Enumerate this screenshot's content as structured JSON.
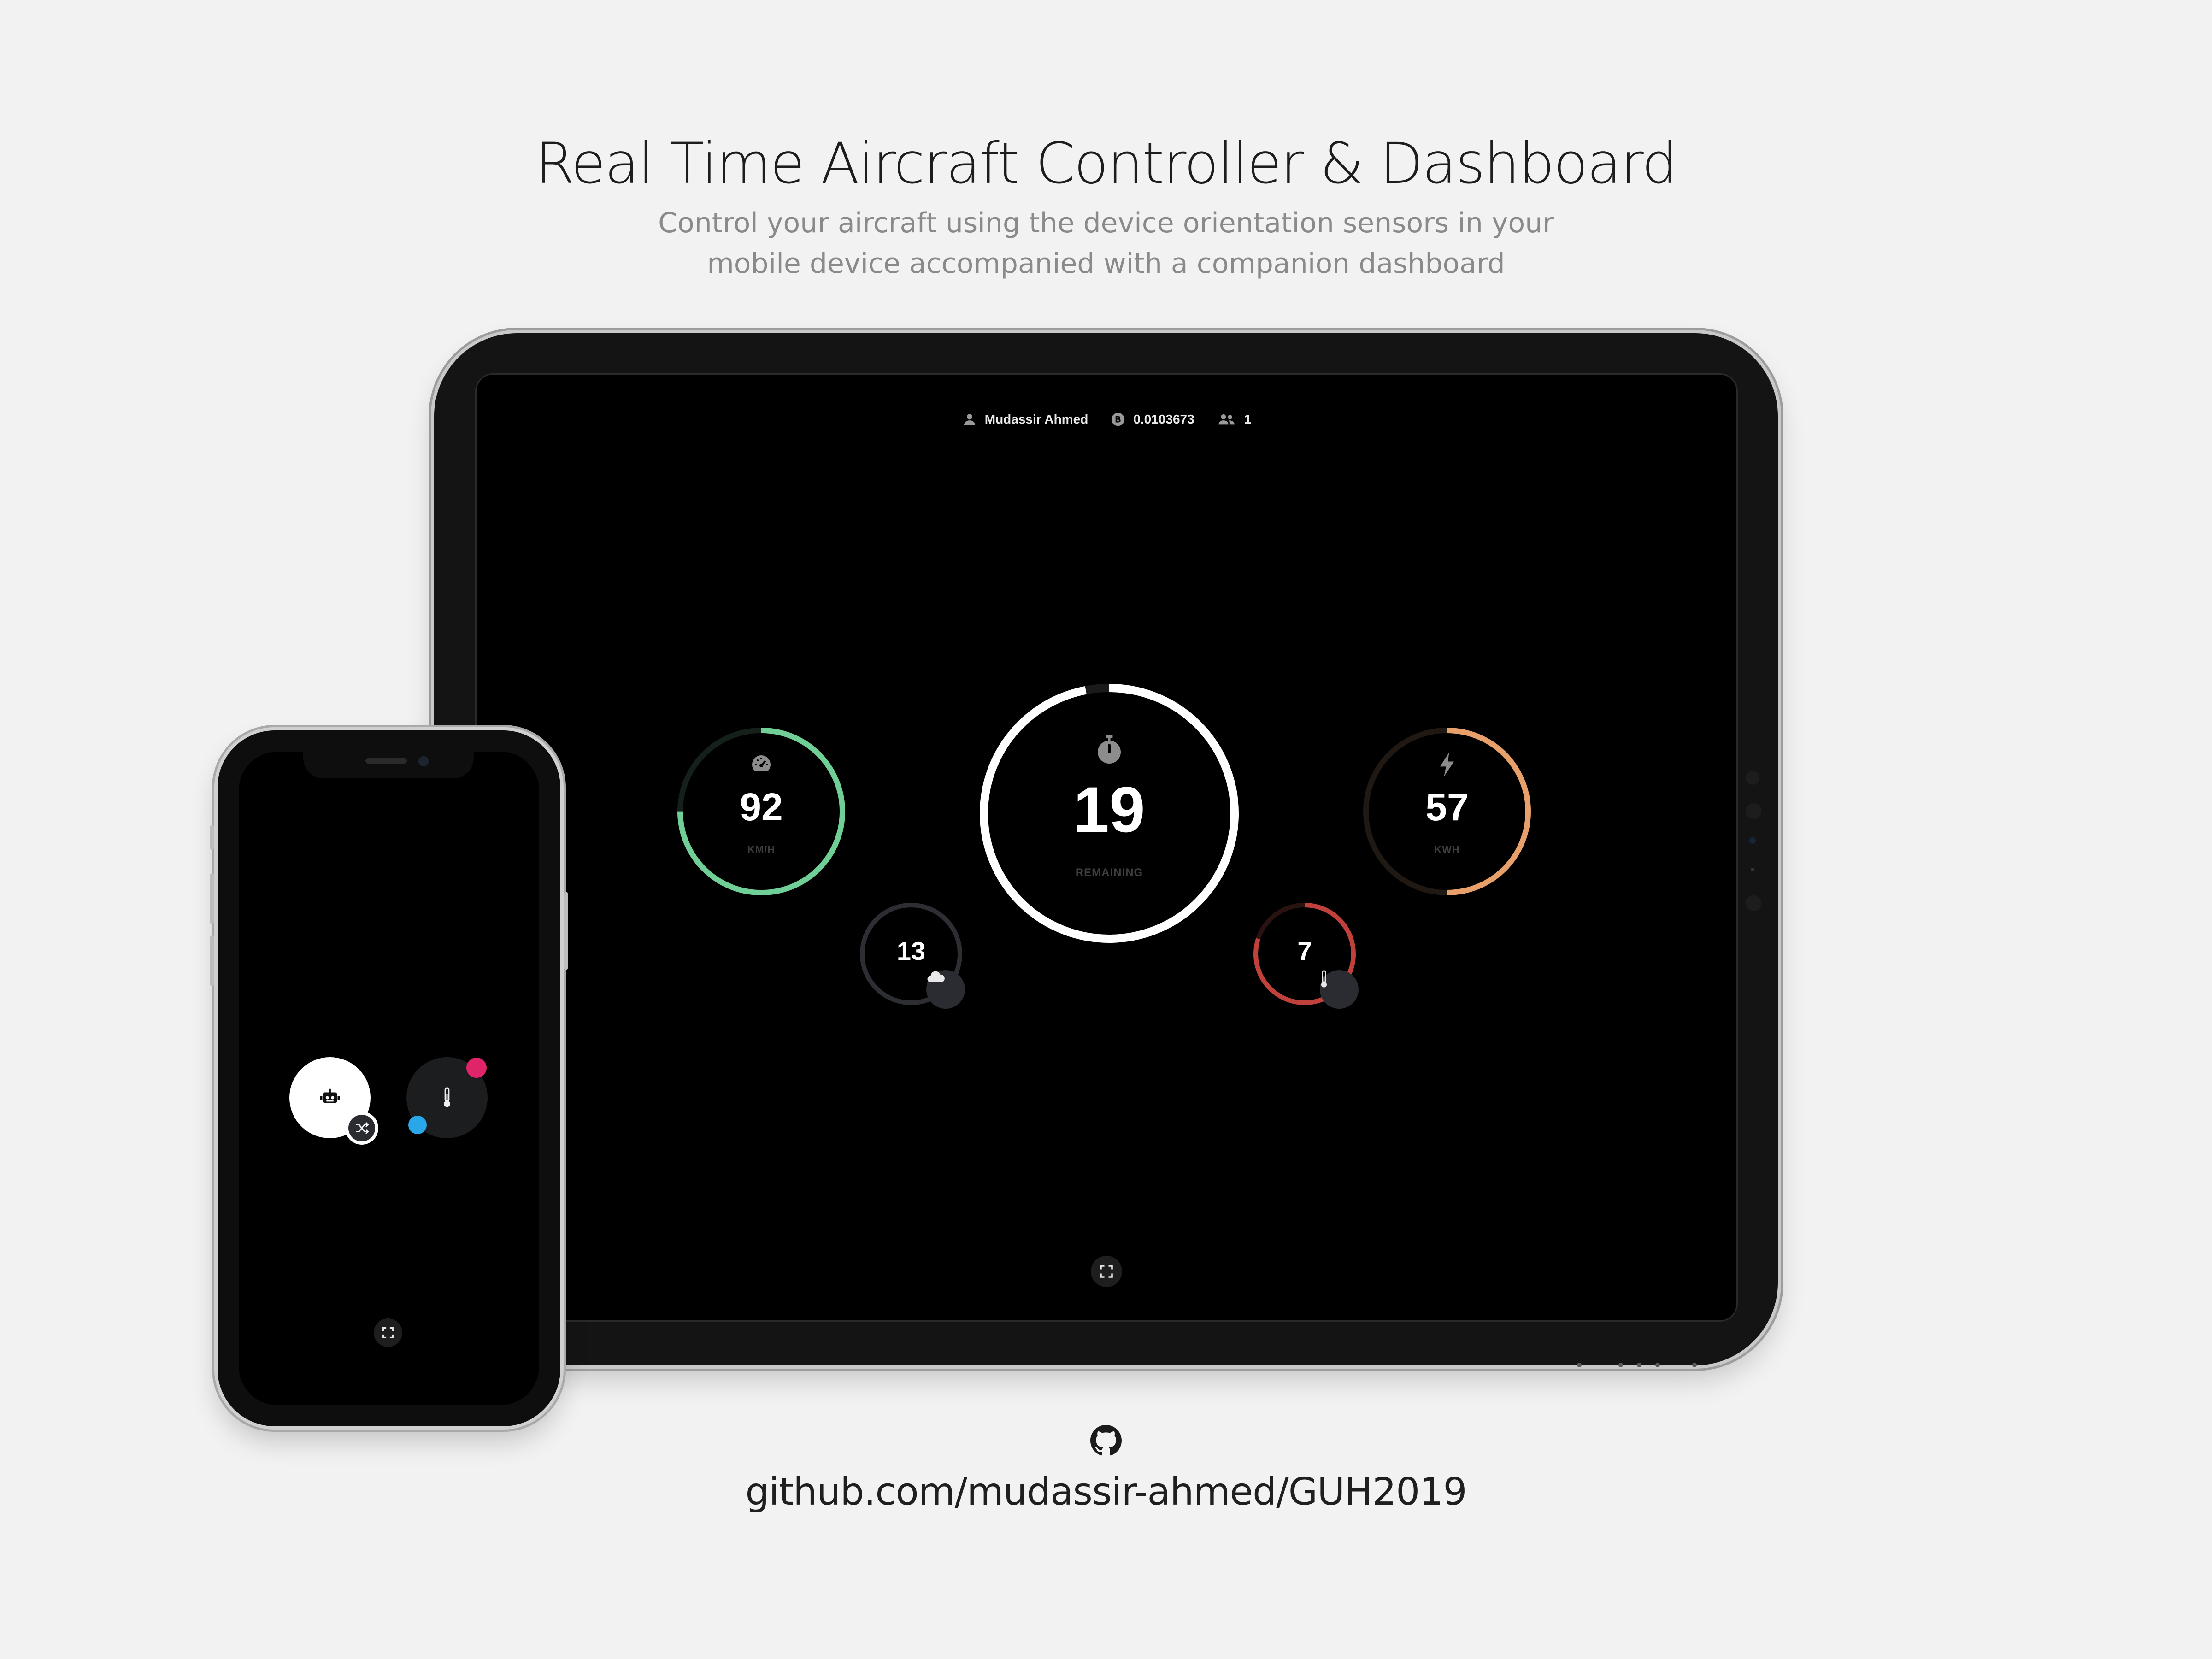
{
  "hero": {
    "title": "Real Time Aircraft Controller & Dashboard",
    "subtitle_line1": "Control your aircraft using the device orientation sensors in your",
    "subtitle_line2": "mobile device accompanied with a companion dashboard"
  },
  "tablet": {
    "topbar": {
      "user_name": "Mudassir Ahmed",
      "balance": "0.0103673",
      "players": "1",
      "icons": [
        "user-icon",
        "coin-icon",
        "users-icon"
      ]
    },
    "gauges": {
      "speed": {
        "value": "92",
        "unit": "KM/H",
        "icon": "speedometer-icon",
        "color": "#6fcf97",
        "fill": 0.75
      },
      "timer": {
        "value": "19",
        "unit": "REMAINING",
        "icon": "stopwatch-icon",
        "color": "#ffffff",
        "fill": 0.97
      },
      "energy": {
        "value": "57",
        "unit": "KWH",
        "icon": "bolt-icon",
        "color": "#e8a06a",
        "fill": 0.5
      },
      "weather": {
        "value": "13",
        "icon": "cloud-icon",
        "color": "#2c2e33",
        "fill": 1.0
      },
      "temperature": {
        "value": "7",
        "icon": "thermometer-icon",
        "color": "#c0403c",
        "fill": 0.8
      }
    },
    "fullscreen_icon": "fullscreen-icon"
  },
  "phone": {
    "controls": {
      "autopilot_icon": "robot-icon",
      "shuffle_icon": "shuffle-icon",
      "temperature_icon": "thermometer-icon"
    },
    "dot_colors": {
      "pink": "#e0246a",
      "blue": "#2aa7e8"
    },
    "fullscreen_icon": "fullscreen-icon"
  },
  "footer": {
    "icon": "github-icon",
    "repo_url": "github.com/mudassir-ahmed/GUH2019"
  }
}
